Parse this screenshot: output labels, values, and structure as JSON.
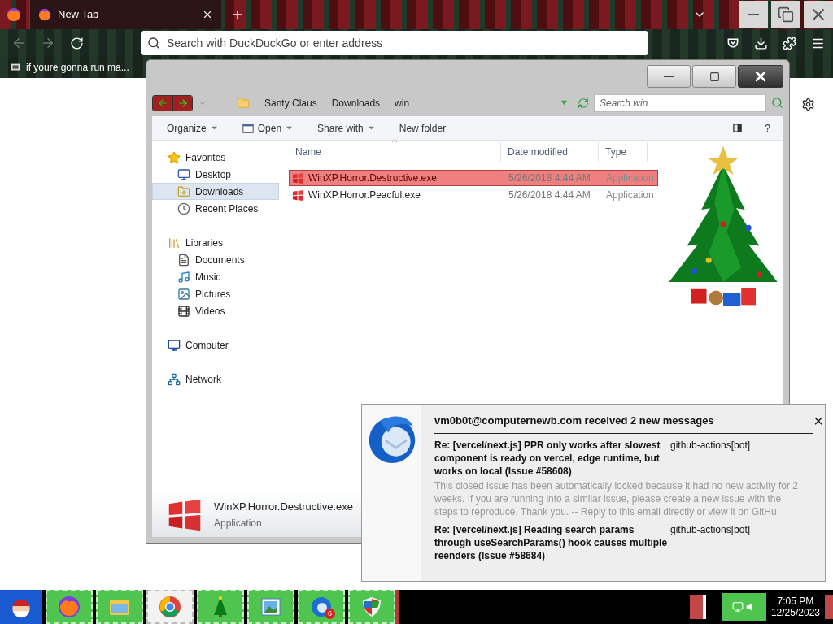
{
  "browser": {
    "tabs": [
      {
        "title": "New Tab",
        "selected": true
      }
    ],
    "address": {
      "placeholder": "Search with DuckDuckGo or enter address"
    },
    "bookmarks": [
      "if youre gonna run ma..."
    ]
  },
  "explorer": {
    "breadcrumb": [
      "Santy Claus",
      "Downloads",
      "win"
    ],
    "search": {
      "placeholder": "Search win"
    },
    "toolbar": [
      {
        "label": "Organize",
        "has_menu": true
      },
      {
        "label": "Open",
        "has_menu": true
      },
      {
        "label": "Share with",
        "has_menu": true
      },
      {
        "label": "New folder",
        "has_menu": false
      }
    ],
    "help": "?",
    "sidebar": [
      {
        "label": "Favorites",
        "kind": "star",
        "selected": false,
        "children": [
          {
            "label": "Desktop",
            "kind": "desktop",
            "selected": false
          },
          {
            "label": "Downloads",
            "kind": "downloads",
            "selected": true
          },
          {
            "label": "Recent Places",
            "kind": "recent",
            "selected": false
          }
        ]
      },
      {
        "label": "Libraries",
        "kind": "library",
        "selected": false,
        "children": [
          {
            "label": "Documents",
            "kind": "document",
            "selected": false
          },
          {
            "label": "Music",
            "kind": "music",
            "selected": false
          },
          {
            "label": "Pictures",
            "kind": "pictures",
            "selected": false
          },
          {
            "label": "Videos",
            "kind": "videos",
            "selected": false
          }
        ]
      },
      {
        "label": "Computer",
        "kind": "computer",
        "selected": false
      },
      {
        "label": "Network",
        "kind": "network",
        "selected": false
      }
    ],
    "columns": [
      "Name",
      "Date modified",
      "Type"
    ],
    "files": [
      {
        "name": "WinXP.Horror.Destructive.exe",
        "date": "5/26/2018 4:44 AM",
        "type": "Application",
        "selected": true
      },
      {
        "name": "WinXP.Horror.Peacful.exe",
        "date": "5/26/2018 4:44 AM",
        "type": "Application",
        "selected": false
      }
    ],
    "details": {
      "name": "WinXP.Horror.Destructive.exe",
      "type": "Application"
    }
  },
  "notification": {
    "title": "vm0b0t@computernewb.com received 2 new messages",
    "close": "×",
    "messages": [
      {
        "subject": "Re: [vercel/next.js] PPR only works after slowest component is ready on vercel, edge runtime, but works on local (Issue #58608)",
        "sender": "github-actions[bot]",
        "preview": "This closed issue has been automatically locked because it had no new activity for 2 weeks. If you are running into a similar issue, please create a new issue with the steps to reproduce. Thank you. -- Reply to this email directly or view it on GitHu"
      },
      {
        "subject": "Re: [vercel/next.js] Reading search params through useSearchParams() hook causes multiple reenders (Issue #58684)",
        "sender": "github-actions[bot]"
      }
    ]
  },
  "taskbar": {
    "items": [
      {
        "kind": "fox",
        "selected": false
      },
      {
        "kind": "folder",
        "selected": false
      },
      {
        "kind": "wheel",
        "selected": true
      },
      {
        "kind": "tree",
        "selected": false
      },
      {
        "kind": "photo",
        "selected": false
      },
      {
        "kind": "mail",
        "selected": false,
        "badge": "6"
      },
      {
        "kind": "shield",
        "selected": false
      }
    ],
    "time": "7:05 PM",
    "date": "12/25/2023"
  }
}
